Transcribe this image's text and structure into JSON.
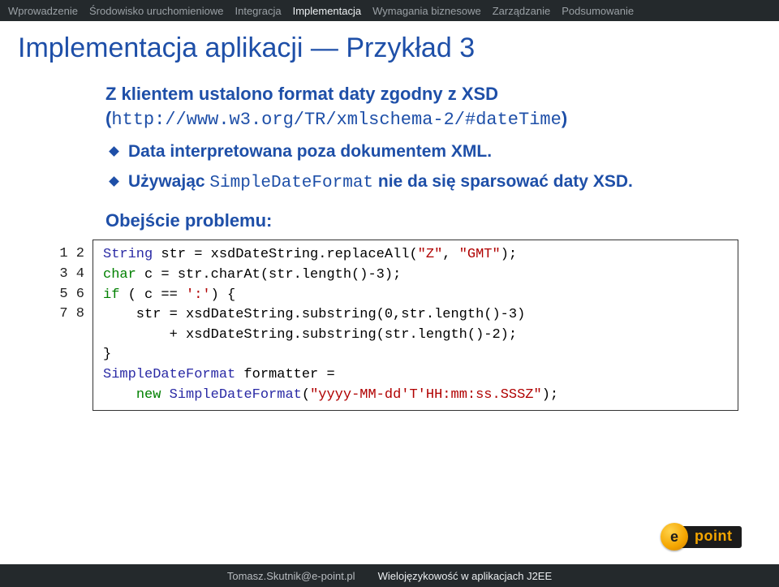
{
  "nav": {
    "items": [
      {
        "label": "Wprowadzenie",
        "active": false
      },
      {
        "label": "Środowisko uruchomieniowe",
        "active": false
      },
      {
        "label": "Integracja",
        "active": false
      },
      {
        "label": "Implementacja",
        "active": true
      },
      {
        "label": "Wymagania biznesowe",
        "active": false
      },
      {
        "label": "Zarządzanie",
        "active": false
      },
      {
        "label": "Podsumowanie",
        "active": false
      }
    ]
  },
  "title": "Implementacja aplikacji — Przykład 3",
  "lead": {
    "pre": "Z klientem ustalono format daty zgodny z XSD ",
    "open_paren": "(",
    "url": "http://www.w3.org/TR/xmlschema-2/#dateTime",
    "close_paren": ")"
  },
  "bullets": [
    {
      "text": "Data interpretowana poza dokumentem XML."
    },
    {
      "pre": "Używając ",
      "mono": "SimpleDateFormat",
      "post": " nie da się sparsować daty XSD."
    }
  ],
  "subhead": "Obejście problemu:",
  "code": {
    "linenos": [
      "1",
      "2",
      "3",
      "4",
      "5",
      "6",
      "7",
      "8"
    ],
    "lines": [
      [
        {
          "t": "ty",
          "v": "String"
        },
        {
          "t": "",
          "v": " str = xsdDateString.replaceAll("
        },
        {
          "t": "str",
          "v": "\"Z\""
        },
        {
          "t": "",
          "v": ", "
        },
        {
          "t": "str",
          "v": "\"GMT\""
        },
        {
          "t": "",
          "v": ");"
        }
      ],
      [
        {
          "t": "kw",
          "v": "char"
        },
        {
          "t": "",
          "v": " c = str.charAt(str.length()-3);"
        }
      ],
      [
        {
          "t": "kw",
          "v": "if"
        },
        {
          "t": "",
          "v": " ( c == "
        },
        {
          "t": "str",
          "v": "':'"
        },
        {
          "t": "",
          "v": ") {"
        }
      ],
      [
        {
          "t": "",
          "v": "    str = xsdDateString.substring(0,str.length()-3)"
        }
      ],
      [
        {
          "t": "",
          "v": "        + xsdDateString.substring(str.length()-2);"
        }
      ],
      [
        {
          "t": "",
          "v": "}"
        }
      ],
      [
        {
          "t": "ty",
          "v": "SimpleDateFormat"
        },
        {
          "t": "",
          "v": " formatter ="
        }
      ],
      [
        {
          "t": "",
          "v": "    "
        },
        {
          "t": "kw",
          "v": "new"
        },
        {
          "t": "",
          "v": " "
        },
        {
          "t": "ty",
          "v": "SimpleDateFormat"
        },
        {
          "t": "",
          "v": "("
        },
        {
          "t": "str",
          "v": "\"yyyy-MM-dd'T'HH:mm:ss.SSSZ\""
        },
        {
          "t": "",
          "v": ");"
        }
      ]
    ]
  },
  "logo": {
    "badge": "e",
    "text": "point"
  },
  "footer": {
    "left": "Tomasz.Skutnik@e-point.pl",
    "right": "Wielojęzykowość w aplikacjach J2EE"
  }
}
